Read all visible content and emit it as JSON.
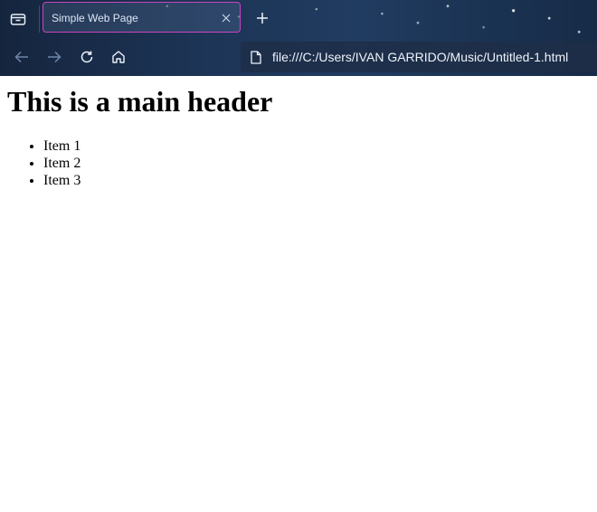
{
  "browser": {
    "tab": {
      "title": "Simple Web Page"
    },
    "address_bar": {
      "url": "file:///C:/Users/IVAN GARRIDO/Music/Untitled-1.html"
    },
    "icons": {
      "tab_manager": "tab-manager-icon",
      "close_tab": "close-icon",
      "new_tab": "plus-icon",
      "back": "arrow-left-icon",
      "forward": "arrow-right-icon",
      "reload": "reload-icon",
      "home": "home-icon",
      "file": "file-icon"
    },
    "colors": {
      "tab_border": "#c944c0",
      "chrome_background": "#1d3557"
    }
  },
  "page": {
    "heading": "This is a main header",
    "items": [
      "Item 1",
      "Item 2",
      "Item 3"
    ]
  }
}
